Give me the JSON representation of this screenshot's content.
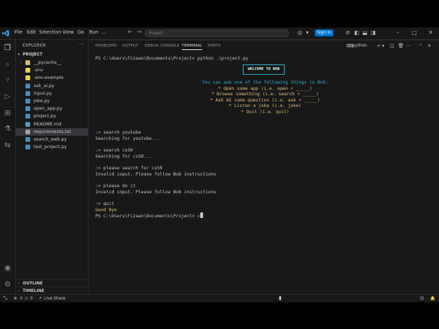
{
  "titlebar": {
    "menu": [
      "File",
      "Edit",
      "Selection",
      "View",
      "Go",
      "Run",
      "…"
    ],
    "search_placeholder": "Project",
    "sign_in": "Sign In"
  },
  "explorer": {
    "header": "EXPLORER",
    "folder": "PROJECT",
    "files": [
      {
        "name": "__pycache__",
        "kind": "folder"
      },
      {
        "name": ".env",
        "kind": "env"
      },
      {
        "name": ".env.example",
        "kind": "env"
      },
      {
        "name": "ask_ai.py",
        "kind": "py"
      },
      {
        "name": "input.py",
        "kind": "py"
      },
      {
        "name": "joke.py",
        "kind": "py"
      },
      {
        "name": "open_app.py",
        "kind": "py"
      },
      {
        "name": "project.py",
        "kind": "py"
      },
      {
        "name": "README.md",
        "kind": "md"
      },
      {
        "name": "requirements.txt",
        "kind": "txt",
        "selected": true
      },
      {
        "name": "search_web.py",
        "kind": "py"
      },
      {
        "name": "test_project.py",
        "kind": "py"
      }
    ],
    "outline": "OUTLINE",
    "timeline": "TIMELINE"
  },
  "panel": {
    "tabs": [
      "PROBLEMS",
      "OUTPUT",
      "DEBUG CONSOLE",
      "TERMINAL",
      "PORTS"
    ],
    "active_tab": "TERMINAL",
    "terminal_name": "python"
  },
  "terminal": {
    "prompt_cmd": "PS C:\\Users\\Fizaan\\Documents\\Project> python .\\project.py",
    "welcome": "WELCOME TO BOB",
    "intro": "You can ask one of the following things to Bob:",
    "options": [
      "* Open some app (i.e. open + _____)",
      "* Browse something (i.e. search + _____)",
      "* Ask AI some question (i.e. ask + _____)",
      "* Listen a joke (i.e. joke)",
      "* Quit (i.e. quit)"
    ],
    "lines": [
      ":> search youtube",
      "Searching for youtube...",
      ":> search cs50",
      "Searching for cs50...",
      ":> please search for cs50",
      "Invalid input. Please follow Bob instructions",
      ":> please do it",
      "Invalid input. Please follow Bob instructions",
      ":> quit"
    ],
    "goodbye": "Good Bye",
    "final_prompt": "PS C:\\Users\\Fizaan\\Documents\\Project> c"
  },
  "statusbar": {
    "errors": "0",
    "warnings": "0",
    "live_share": "Live Share"
  },
  "colors": {
    "accent": "#0078d4",
    "welcome_border": "#29b8db",
    "options": "#e5c07b"
  }
}
